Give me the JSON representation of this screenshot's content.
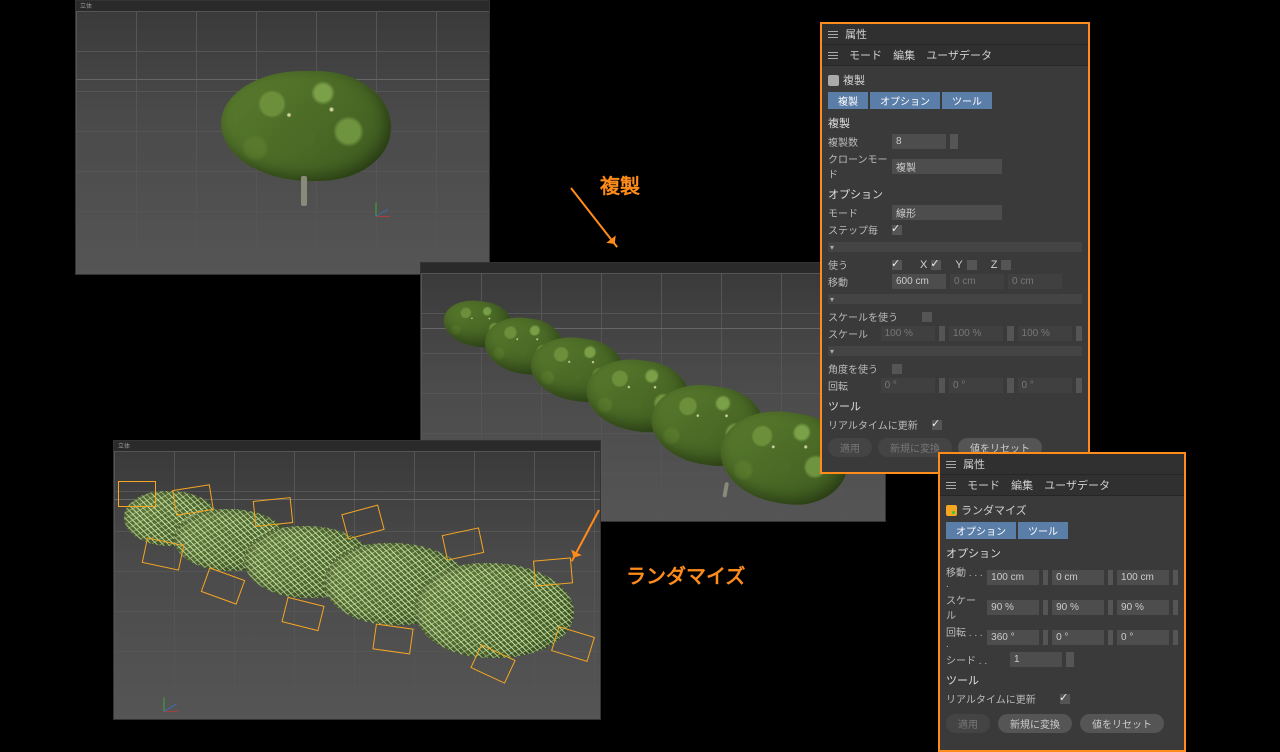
{
  "viewports": {
    "topleft_title": "立体"
  },
  "annotations": {
    "duplicate": "複製",
    "randomize": "ランダマイズ"
  },
  "panel1": {
    "title": "属性",
    "menu": [
      "モード",
      "編集",
      "ユーザデータ"
    ],
    "object_name": "複製",
    "tabs": {
      "a": "複製",
      "b": "オプション",
      "c": "ツール"
    },
    "section_duplicate": "複製",
    "copies_label": "複製数",
    "copies_value": "8",
    "clonemode_label": "クローンモード",
    "clonemode_value": "複製",
    "section_option": "オプション",
    "mode_label": "モード",
    "mode_value": "線形",
    "step_label": "ステップ毎",
    "use_label": "使う",
    "axis_x": "X",
    "axis_y": "Y",
    "axis_z": "Z",
    "move_label": "移動",
    "move_x": "600 cm",
    "move_y": "0 cm",
    "move_z": "0 cm",
    "scale_use_label": "スケールを使う",
    "scale_label": "スケール",
    "scale_x": "100 %",
    "scale_y": "100 %",
    "scale_z": "100 %",
    "rot_use_label": "角度を使う",
    "rot_label": "回転",
    "rot_h": "0 °",
    "rot_p": "0 °",
    "rot_b": "0 °",
    "section_tool": "ツール",
    "realtime_label": "リアルタイムに更新",
    "btn_apply": "適用",
    "btn_new": "新規に変換",
    "btn_reset": "値をリセット"
  },
  "panel2": {
    "title": "属性",
    "menu": [
      "モード",
      "編集",
      "ユーザデータ"
    ],
    "object_name": "ランダマイズ",
    "tabs": {
      "a": "オプション",
      "b": "ツール"
    },
    "section_option": "オプション",
    "move_label": "移動 . . . .",
    "move_x": "100 cm",
    "move_y": "0 cm",
    "move_z": "100 cm",
    "scale_label": "スケール",
    "scale_x": "90 %",
    "scale_y": "90 %",
    "scale_z": "90 %",
    "rot_label": "回転 . . . .",
    "rot_h": "360 °",
    "rot_p": "0 °",
    "rot_b": "0 °",
    "seed_label": "シード . .",
    "seed_value": "1",
    "section_tool": "ツール",
    "realtime_label": "リアルタイムに更新",
    "btn_apply": "適用",
    "btn_new": "新規に変換",
    "btn_reset": "値をリセット"
  }
}
